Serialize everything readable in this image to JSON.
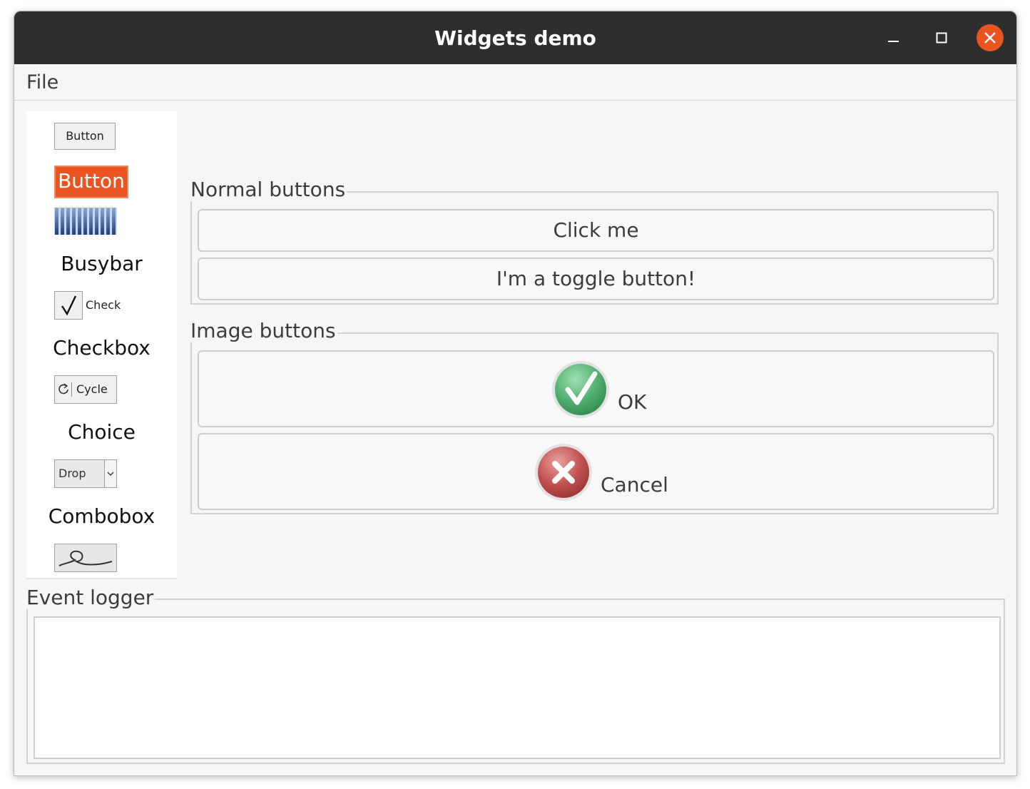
{
  "window": {
    "title": "Widgets demo"
  },
  "menu": {
    "file": "File"
  },
  "sidebar": {
    "button_small": "Button",
    "button_orange": "Button",
    "busybar_label": "Busybar",
    "check_text": "Check",
    "checkbox_label": "Checkbox",
    "cycle_text": "Cycle",
    "choice_label": "Choice",
    "drop_text": "Drop",
    "combobox_label": "Combobox"
  },
  "normal_buttons": {
    "title": "Normal buttons",
    "click_me": "Click me",
    "toggle": "I'm a toggle button!"
  },
  "image_buttons": {
    "title": "Image buttons",
    "ok": "OK",
    "cancel": "Cancel"
  },
  "event_logger": {
    "title": "Event logger"
  },
  "colors": {
    "titlebar": "#2f2e2e",
    "accent": "#e95420",
    "ok_green": "#4fae6d",
    "cancel_red": "#c0504f"
  },
  "icons": [
    "minimize-icon",
    "maximize-icon",
    "close-icon",
    "busybar-icon",
    "checkmark-icon",
    "cycle-icon",
    "chevron-down-icon",
    "lasso-icon",
    "ok-check-icon",
    "cancel-x-icon"
  ]
}
